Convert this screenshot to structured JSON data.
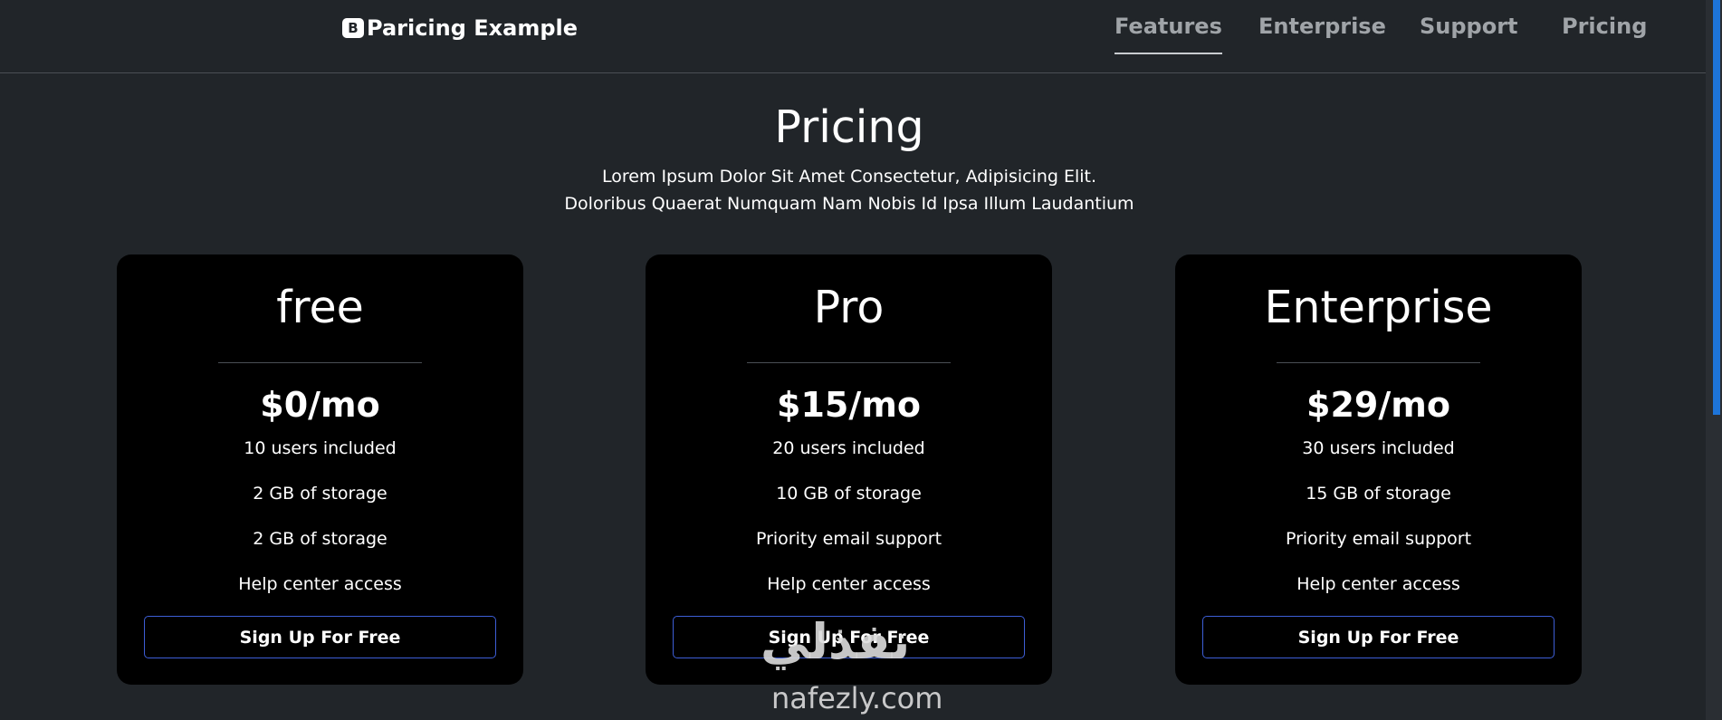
{
  "header": {
    "brand_icon": "B",
    "brand": "Paricing Example",
    "nav": [
      {
        "label": "Features",
        "active": true
      },
      {
        "label": "Enterprise",
        "active": false
      },
      {
        "label": "Support",
        "active": false
      },
      {
        "label": "Pricing",
        "active": false
      }
    ]
  },
  "hero": {
    "title": "Pricing",
    "line1": "Lorem Ipsum Dolor Sit Amet Consectetur, Adipisicing Elit.",
    "line2": "Doloribus Quaerat Numquam Nam Nobis Id Ipsa Illum Laudantium"
  },
  "plans": [
    {
      "title": "free",
      "price": "$0/mo",
      "features": [
        "10 users included",
        "2 GB of storage",
        "2 GB of storage",
        "Help center access"
      ],
      "button": "Sign Up For Free"
    },
    {
      "title": "Pro",
      "price": "$15/mo",
      "features": [
        "20 users included",
        "10 GB of storage",
        "Priority email support",
        "Help center access"
      ],
      "button": "Sign Up For Free"
    },
    {
      "title": "Enterprise",
      "price": "$29/mo",
      "features": [
        "30 users included",
        "15 GB of storage",
        "Priority email support",
        "Help center access"
      ],
      "button": "Sign Up For Free"
    }
  ],
  "watermark": {
    "arabic": "نفذلي",
    "latin": "nafezly.com"
  },
  "colors": {
    "background": "#212529",
    "card": "#000000",
    "button_border": "#3d5ed6",
    "nav_text": "#a0a4a8",
    "scroll_thumb": "#1d74d9"
  }
}
